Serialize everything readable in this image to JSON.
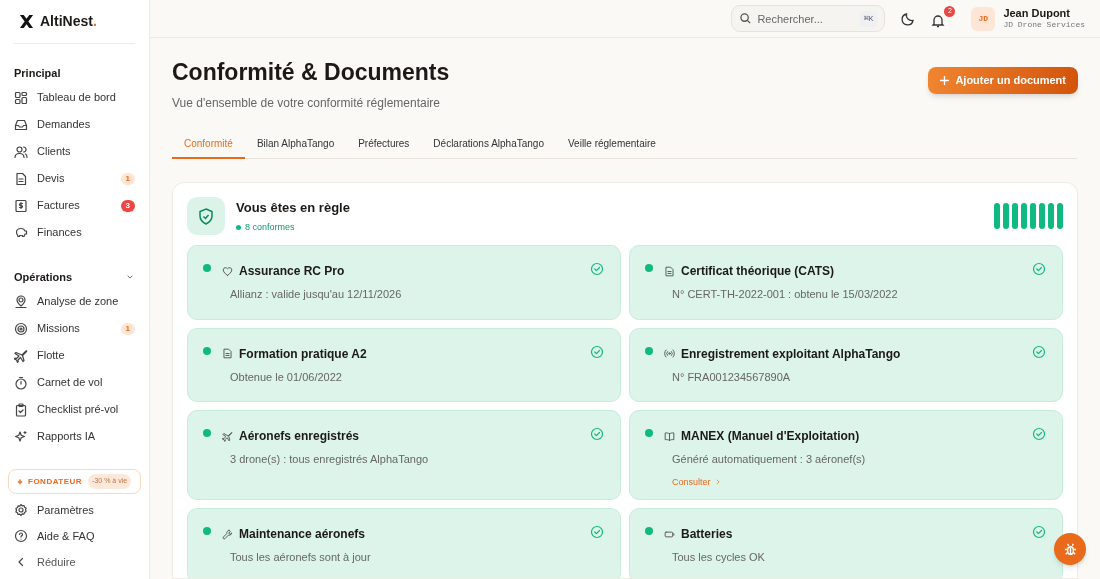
{
  "brand": {
    "name": "AltiNest",
    "dot": "."
  },
  "sidebar": {
    "sections": [
      {
        "title": "Principal",
        "collapsible": false,
        "items": [
          {
            "label": "Tableau de bord"
          },
          {
            "label": "Demandes"
          },
          {
            "label": "Clients"
          },
          {
            "label": "Devis",
            "badge": "1",
            "kind": "soft"
          },
          {
            "label": "Factures",
            "badge": "3",
            "kind": "alert"
          },
          {
            "label": "Finances"
          }
        ]
      },
      {
        "title": "Opérations",
        "collapsible": true,
        "items": [
          {
            "label": "Analyse de zone"
          },
          {
            "label": "Missions",
            "badge": "1",
            "kind": "soft"
          },
          {
            "label": "Flotte"
          },
          {
            "label": "Carnet de vol"
          },
          {
            "label": "Checklist pré-vol"
          },
          {
            "label": "Rapports IA"
          }
        ]
      }
    ],
    "promo": {
      "label": "FONDATEUR",
      "tag": "-30 % à vie"
    },
    "footer": [
      {
        "label": "Paramètres"
      },
      {
        "label": "Aide & FAQ"
      },
      {
        "label": "Réduire"
      }
    ]
  },
  "header": {
    "search": {
      "placeholder": "Rechercher...",
      "shortcut": "⌘K"
    },
    "notifications": "2",
    "user": {
      "initials": "JD",
      "name": "Jean Dupont",
      "company": "JD Drone Services"
    }
  },
  "page": {
    "title": "Conformité & Documents",
    "subtitle": "Vue d'ensemble de votre conformité réglementaire",
    "action": "Ajouter un document"
  },
  "tabs": [
    {
      "label": "Conformité",
      "selected": true
    },
    {
      "label": "Bilan AlphaTango",
      "selected": false
    },
    {
      "label": "Préfectures",
      "selected": false
    },
    {
      "label": "Déclarations AlphaTango",
      "selected": false
    },
    {
      "label": "Veille réglementaire",
      "selected": false
    }
  ],
  "summary": {
    "title": "Vous êtes en règle",
    "count": "8 conformes"
  },
  "items": [
    {
      "title": "Assurance RC Pro",
      "detail": "Allianz : valide jusqu'au 12/11/2026"
    },
    {
      "title": "Certificat théorique (CATS)",
      "detail": "N° CERT-TH-2022-001 : obtenu le 15/03/2022"
    },
    {
      "title": "Formation pratique A2",
      "detail": "Obtenue le 01/06/2022"
    },
    {
      "title": "Enregistrement exploitant AlphaTango",
      "detail": "N° FRA001234567890A"
    },
    {
      "title": "Aéronefs enregistrés",
      "detail": "3 drone(s) : tous enregistrés AlphaTango"
    },
    {
      "title": "MANEX (Manuel d'Exploitation)",
      "detail": "Généré automatiquement : 3 aéronef(s)",
      "link": "Consulter"
    },
    {
      "title": "Maintenance aéronefs",
      "detail": "Tous les aéronefs sont à jour"
    },
    {
      "title": "Batteries",
      "detail": "Tous les cycles OK"
    }
  ]
}
